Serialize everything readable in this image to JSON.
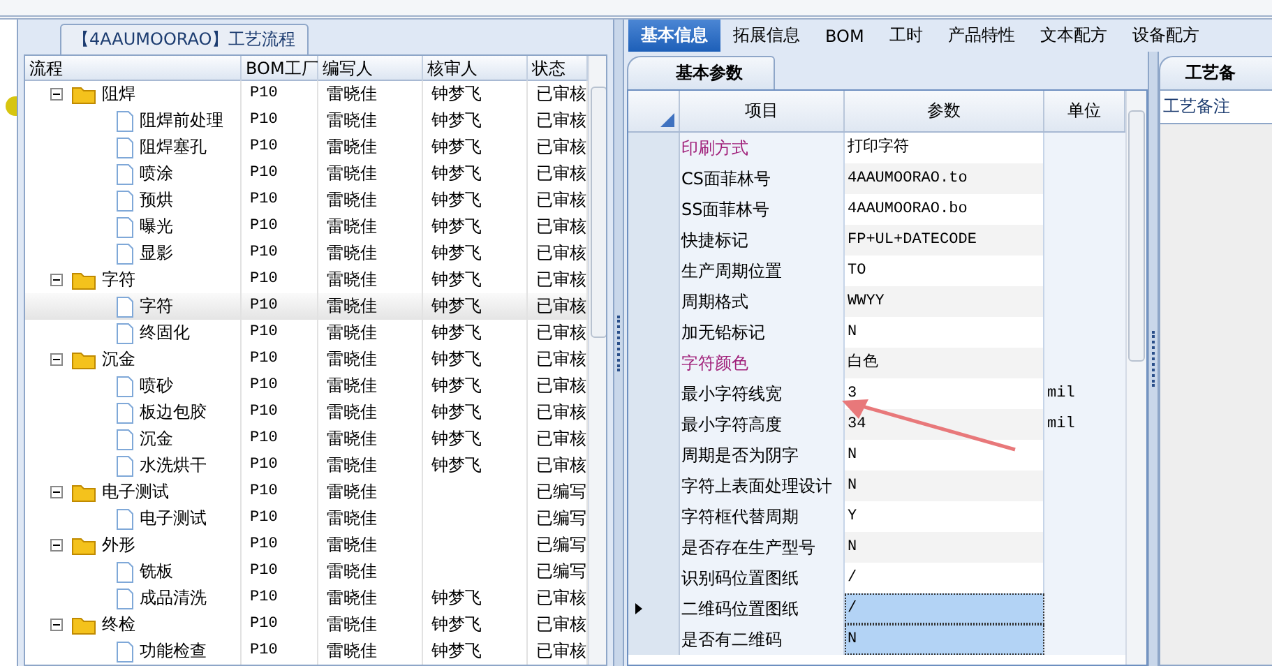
{
  "process_panel": {
    "title": "【4AAUMOORAO】工艺流程",
    "columns": [
      "流程",
      "BOM工厂",
      "编写人",
      "核审人",
      "状态"
    ],
    "tree": [
      {
        "name": "阻焊",
        "bom": "P10",
        "writer": "雷晓佳",
        "reviewer": "钟梦飞",
        "status": "已审核",
        "expanded": true,
        "selected": false,
        "children": [
          {
            "name": "阻焊前处理",
            "bom": "P10",
            "writer": "雷晓佳",
            "reviewer": "钟梦飞",
            "status": "已审核",
            "selected": false
          },
          {
            "name": "阻焊塞孔",
            "bom": "P10",
            "writer": "雷晓佳",
            "reviewer": "钟梦飞",
            "status": "已审核",
            "selected": false
          },
          {
            "name": "喷涂",
            "bom": "P10",
            "writer": "雷晓佳",
            "reviewer": "钟梦飞",
            "status": "已审核",
            "selected": false
          },
          {
            "name": "预烘",
            "bom": "P10",
            "writer": "雷晓佳",
            "reviewer": "钟梦飞",
            "status": "已审核",
            "selected": false
          },
          {
            "name": "曝光",
            "bom": "P10",
            "writer": "雷晓佳",
            "reviewer": "钟梦飞",
            "status": "已审核",
            "selected": false
          },
          {
            "name": "显影",
            "bom": "P10",
            "writer": "雷晓佳",
            "reviewer": "钟梦飞",
            "status": "已审核",
            "selected": false
          }
        ]
      },
      {
        "name": "字符",
        "bom": "P10",
        "writer": "雷晓佳",
        "reviewer": "钟梦飞",
        "status": "已审核",
        "expanded": true,
        "selected": false,
        "children": [
          {
            "name": "字符",
            "bom": "P10",
            "writer": "雷晓佳",
            "reviewer": "钟梦飞",
            "status": "已审核",
            "selected": true
          },
          {
            "name": "终固化",
            "bom": "P10",
            "writer": "雷晓佳",
            "reviewer": "钟梦飞",
            "status": "已审核",
            "selected": false
          }
        ]
      },
      {
        "name": "沉金",
        "bom": "P10",
        "writer": "雷晓佳",
        "reviewer": "钟梦飞",
        "status": "已审核",
        "expanded": true,
        "selected": false,
        "children": [
          {
            "name": "喷砂",
            "bom": "P10",
            "writer": "雷晓佳",
            "reviewer": "钟梦飞",
            "status": "已审核",
            "selected": false
          },
          {
            "name": "板边包胶",
            "bom": "P10",
            "writer": "雷晓佳",
            "reviewer": "钟梦飞",
            "status": "已审核",
            "selected": false
          },
          {
            "name": "沉金",
            "bom": "P10",
            "writer": "雷晓佳",
            "reviewer": "钟梦飞",
            "status": "已审核",
            "selected": false
          },
          {
            "name": "水洗烘干",
            "bom": "P10",
            "writer": "雷晓佳",
            "reviewer": "钟梦飞",
            "status": "已审核",
            "selected": false
          }
        ]
      },
      {
        "name": "电子测试",
        "bom": "P10",
        "writer": "雷晓佳",
        "status": "已编写",
        "expanded": true,
        "selected": false,
        "children": [
          {
            "name": "电子测试",
            "bom": "P10",
            "writer": "雷晓佳",
            "status": "已编写",
            "selected": false
          }
        ]
      },
      {
        "name": "外形",
        "bom": "P10",
        "writer": "雷晓佳",
        "status": "已编写",
        "expanded": true,
        "selected": false,
        "children": [
          {
            "name": "铣板",
            "bom": "P10",
            "writer": "雷晓佳",
            "status": "已编写",
            "selected": false
          },
          {
            "name": "成品清洗",
            "bom": "P10",
            "writer": "雷晓佳",
            "reviewer": "钟梦飞",
            "status": "已审核",
            "selected": false
          }
        ]
      },
      {
        "name": "终检",
        "bom": "P10",
        "writer": "雷晓佳",
        "reviewer": "钟梦飞",
        "status": "已审核",
        "expanded": true,
        "selected": false,
        "children": [
          {
            "name": "功能检查",
            "bom": "P10",
            "writer": "雷晓佳",
            "reviewer": "钟梦飞",
            "status": "已审核",
            "selected": false
          }
        ]
      }
    ]
  },
  "tabs": [
    {
      "label": "基本信息",
      "selected": true
    },
    {
      "label": "拓展信息",
      "selected": false
    },
    {
      "label": "BOM",
      "selected": false
    },
    {
      "label": "工时",
      "selected": false
    },
    {
      "label": "产品特性",
      "selected": false
    },
    {
      "label": "文本配方",
      "selected": false
    },
    {
      "label": "设备配方",
      "selected": false
    }
  ],
  "sub_tab": "基本参数",
  "params": {
    "columns": [
      "项目",
      "参数",
      "单位"
    ],
    "rows": [
      {
        "item": "印刷方式",
        "value": "打印字符",
        "color": "#a0207a",
        "current": false,
        "selected": false
      },
      {
        "item": "CS面菲林号",
        "value": "4AAUMOORAO.to",
        "color": "#000000",
        "current": false,
        "selected": false
      },
      {
        "item": "SS面菲林号",
        "value": "4AAUMOORAO.bo",
        "color": "#000000",
        "current": false,
        "selected": false
      },
      {
        "item": "快捷标记",
        "value": "FP+UL+DATECODE",
        "color": "#000000",
        "current": false,
        "selected": false
      },
      {
        "item": "生产周期位置",
        "value": "TO",
        "color": "#000000",
        "current": false,
        "selected": false
      },
      {
        "item": "周期格式",
        "value": "WWYY",
        "color": "#000000",
        "current": false,
        "selected": false
      },
      {
        "item": "加无铅标记",
        "value": "N",
        "color": "#000000",
        "current": false,
        "selected": false
      },
      {
        "item": "字符颜色",
        "value": "白色",
        "color": "#a0207a",
        "current": false,
        "selected": false
      },
      {
        "item": "最小字符线宽",
        "value": "3",
        "unit": "mil",
        "color": "#000000",
        "current": false,
        "selected": false
      },
      {
        "item": "最小字符高度",
        "value": "34",
        "unit": "mil",
        "color": "#000000",
        "current": false,
        "selected": false
      },
      {
        "item": "周期是否为阴字",
        "value": "N",
        "color": "#000000",
        "current": false,
        "selected": false
      },
      {
        "item": "字符上表面处理设计",
        "value": "N",
        "color": "#000000",
        "current": false,
        "selected": false
      },
      {
        "item": "字符框代替周期",
        "value": "Y",
        "color": "#000000",
        "current": false,
        "selected": false
      },
      {
        "item": "是否存在生产型号",
        "value": "N",
        "color": "#000000",
        "current": false,
        "selected": false
      },
      {
        "item": "识别码位置图纸",
        "value": "/",
        "color": "#000000",
        "current": false,
        "selected": false
      },
      {
        "item": "二维码位置图纸",
        "value": "/",
        "color": "#000000",
        "current": true,
        "selected": true
      },
      {
        "item": "是否有二维码",
        "value": "N",
        "color": "#000000",
        "current": false,
        "selected": true
      }
    ]
  },
  "notes_panel": {
    "title": "工艺备",
    "label": "工艺备注"
  }
}
